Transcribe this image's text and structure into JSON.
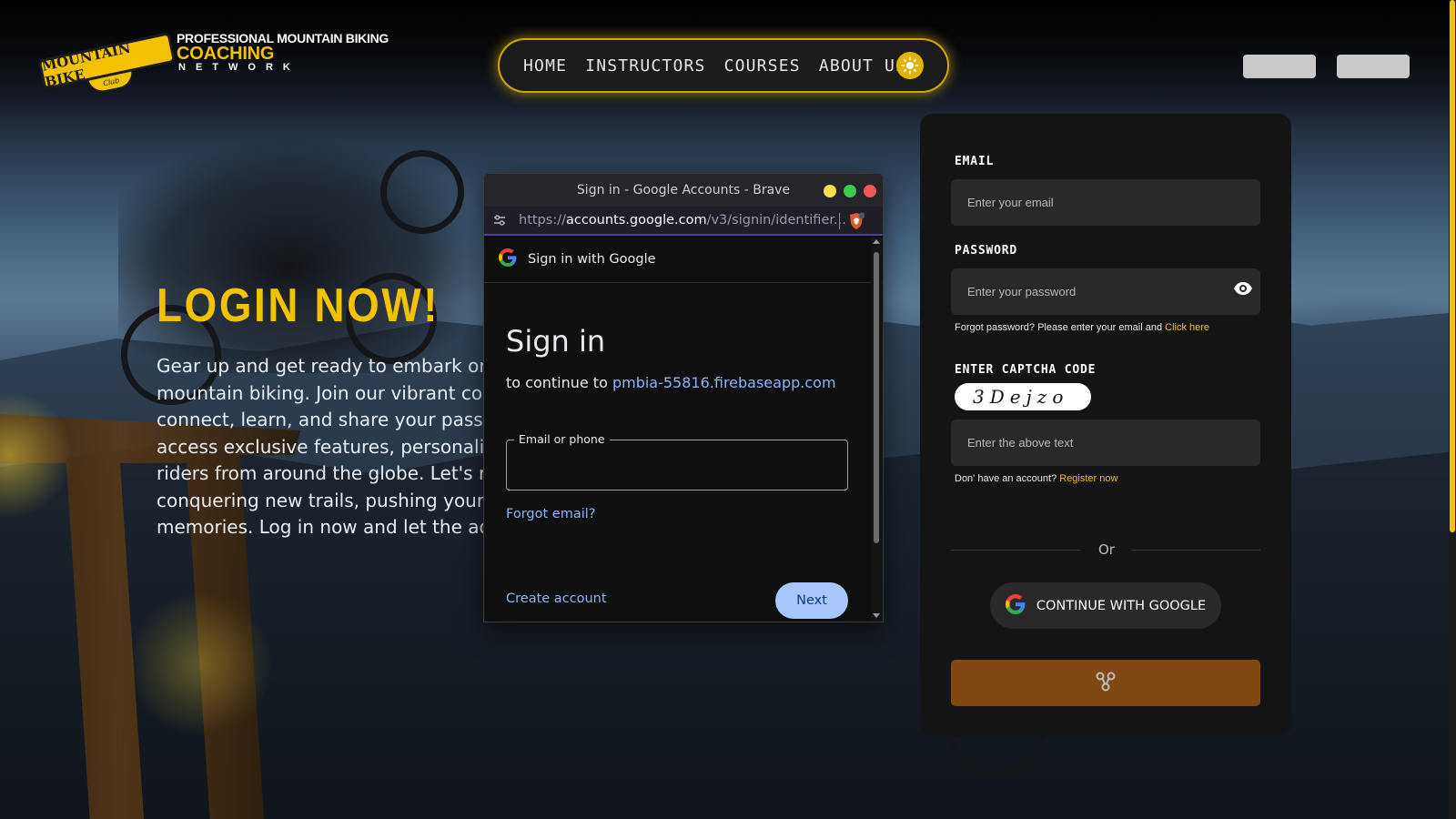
{
  "colors": {
    "accent_yellow": "#f2c200",
    "card_bg": "#141414",
    "field_bg": "#2a2828",
    "submit_bg": "#7e4a12",
    "google_link": "#8ab4f8",
    "google_button": "#a8c7fa"
  },
  "header": {
    "logo": {
      "badge_text": "MOUNTAIN BIKE",
      "badge_sub": "Club",
      "line1": "PROFESSIONAL MOUNTAIN BIKING",
      "line2": "COACHING",
      "line3": "NETWORK"
    },
    "nav": [
      {
        "label": "HOME"
      },
      {
        "label": "INSTRUCTORS"
      },
      {
        "label": "COURSES"
      },
      {
        "label": "ABOUT US"
      }
    ],
    "theme_icon": "sun-icon"
  },
  "hero": {
    "title": "LOGIN NOW!",
    "paragraph": "Gear up and get ready to embark or\nmountain biking. Join our vibrant cor\nconnect, learn, and share your passic\naccess exclusive features, personaliz\nriders from around the globe. Let's ri\nconquering new trails, pushing your l\nmemories. Log in now and let the adv"
  },
  "login": {
    "email_label": "EMAIL",
    "email_placeholder": "Enter your email",
    "password_label": "PASSWORD",
    "password_placeholder": "Enter your password",
    "forgot_text": "Forgot password? Please enter your email and ",
    "forgot_link": "Click here",
    "captcha_label": "ENTER CAPTCHA CODE",
    "captcha_code": "3Dejzo",
    "captcha_placeholder": "Enter the above text",
    "register_text": "Don' have an account? ",
    "register_link": "Register now",
    "or_text": "Or",
    "google_button": "CONTINUE WITH GOOGLE",
    "submit_icon": "spinner-icon"
  },
  "popup": {
    "window_title": "Sign in - Google Accounts - Brave",
    "url_scheme": "https://",
    "url_host": "accounts.google.com",
    "url_path": "/v3/signin/identifier...",
    "header": "Sign in with Google",
    "title": "Sign in",
    "continue_prefix": "to continue to ",
    "continue_domain": "pmbia-55816.firebaseapp.com",
    "email_label": "Email or phone",
    "email_value": "",
    "forgot_email": "Forgot email?",
    "create_account": "Create account",
    "next": "Next"
  }
}
